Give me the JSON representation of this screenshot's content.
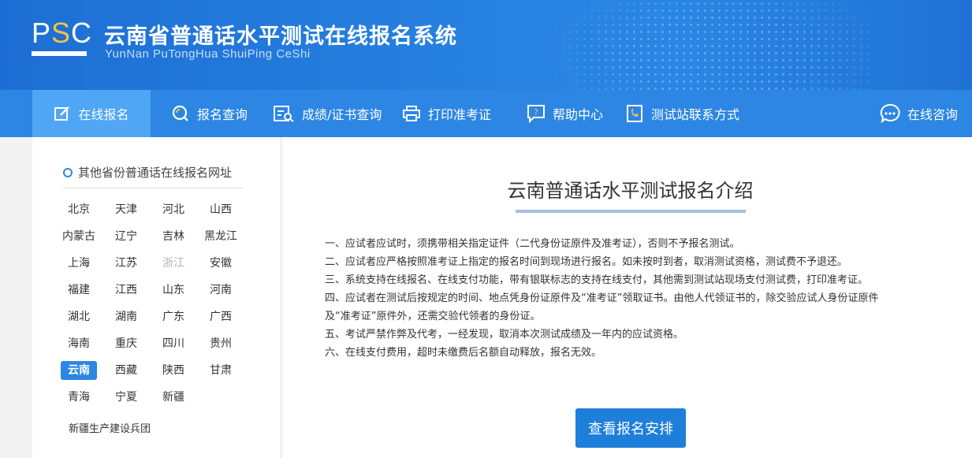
{
  "header": {
    "logo": {
      "p": "P",
      "s": "S",
      "c": "C"
    },
    "title": "云南省普通话水平测试在线报名系统",
    "subtitle": "YunNan PuTongHua ShuiPing CeShi"
  },
  "nav": {
    "items": [
      {
        "label": "在线报名",
        "icon": "edit-icon"
      },
      {
        "label": "报名查询",
        "icon": "search-icon"
      },
      {
        "label": "成绩/证书查询",
        "icon": "certificate-search-icon"
      },
      {
        "label": "打印准考证",
        "icon": "printer-icon"
      },
      {
        "label": "帮助中心",
        "icon": "help-icon"
      },
      {
        "label": "测试站联系方式",
        "icon": "phone-book-icon"
      },
      {
        "label": "在线咨询",
        "icon": "chat-icon"
      }
    ]
  },
  "sidebar": {
    "title": "其他省份普通话在线报名网址",
    "provinces": [
      "北京",
      "天津",
      "河北",
      "山西",
      "内蒙古",
      "辽宁",
      "吉林",
      "黑龙江",
      "上海",
      "江苏",
      "浙江",
      "安徽",
      "福建",
      "江西",
      "山东",
      "河南",
      "湖北",
      "湖南",
      "广东",
      "广西",
      "海南",
      "重庆",
      "四川",
      "贵州",
      "云南",
      "西藏",
      "陕西",
      "甘肃",
      "青海",
      "宁夏",
      "新疆"
    ],
    "selected": "云南",
    "disabled": "浙江",
    "extra": "新疆生产建设兵团"
  },
  "main": {
    "title": "云南普通话水平测试报名介绍",
    "rules": [
      "一、应试者应试时，须携带相关指定证件（二代身份证原件及准考证），否则不予报名测试。",
      "二、应试者应严格按照准考证上指定的报名时间到现场进行报名。如未按时到者，取消测试资格，测试费不予退还。",
      "三、系统支持在线报名、在线支付功能，带有银联标志的支持在线支付，其他需到测试站现场支付测试费，打印准考证。",
      "四、应试者在测试后按规定的时间、地点凭身份证原件及“准考证”领取证书。由他人代领证书的，除交验应试人身份证原件",
      "及“准考证”原件外，还需交验代领者的身份证。",
      "五、考试严禁作弊及代考，一经发现，取消本次测试成绩及一年内的应试资格。",
      "六、在线支付费用，超时未缴费后名额自动释放，报名无效。"
    ],
    "button": "查看报名安排"
  },
  "colors": {
    "brand": "#2d86e3",
    "nav_active": "#4ea6f5",
    "button": "#1e7fdb"
  }
}
